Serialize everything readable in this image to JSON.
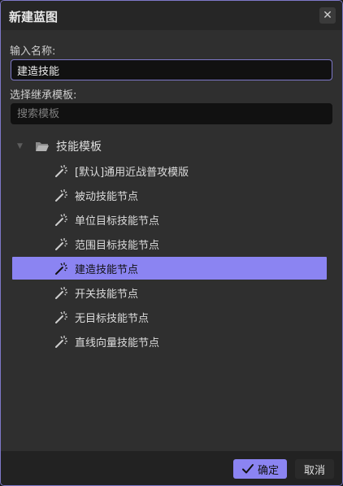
{
  "dialog": {
    "title": "新建蓝图",
    "close_glyph": "✕"
  },
  "name_section": {
    "label": "输入名称:",
    "value": "建造技能"
  },
  "template_section": {
    "label": "选择继承模板:",
    "search_placeholder": "搜索模板"
  },
  "tree": {
    "root_label": "技能模板",
    "root_icon": "folder-open-icon",
    "item_icon": "magic-wand-icon",
    "items": [
      {
        "label": "[默认]通用近战普攻模版",
        "selected": false
      },
      {
        "label": "被动技能节点",
        "selected": false
      },
      {
        "label": "单位目标技能节点",
        "selected": false
      },
      {
        "label": "范围目标技能节点",
        "selected": false
      },
      {
        "label": "建造技能节点",
        "selected": true
      },
      {
        "label": "开关技能节点",
        "selected": false
      },
      {
        "label": "无目标技能节点",
        "selected": false
      },
      {
        "label": "直线向量技能节点",
        "selected": false
      }
    ]
  },
  "footer": {
    "ok_label": "确定",
    "cancel_label": "取消"
  },
  "colors": {
    "accent": "#8b84f2",
    "border": "#7e78c8",
    "panel": "#2f2f2f",
    "input_bg": "#111111"
  }
}
